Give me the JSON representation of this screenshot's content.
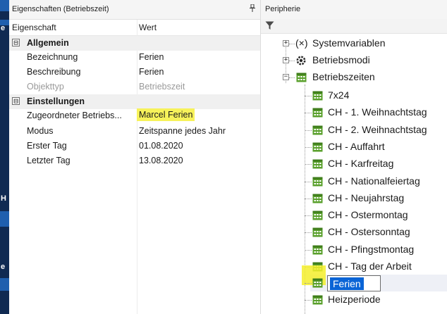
{
  "desktop": {
    "letters": [
      "e",
      "H",
      "e"
    ]
  },
  "properties_panel": {
    "title": "Eigenschaften (Betriebszeit)",
    "pin_icon": "pin-icon",
    "columns": {
      "property": "Eigenschaft",
      "value": "Wert"
    },
    "groups": [
      {
        "expander": "⊟",
        "label": "Allgemein",
        "rows": [
          {
            "label": "Bezeichnung",
            "value": "Ferien"
          },
          {
            "label": "Beschreibung",
            "value": "Ferien"
          },
          {
            "label": "Objekttyp",
            "value": "Betriebszeit",
            "dimmed": true
          }
        ]
      },
      {
        "expander": "⊟",
        "label": "Einstellungen",
        "rows": [
          {
            "label": "Zugeordneter Betriebs...",
            "value": "Marcel Ferien",
            "highlighted": true
          },
          {
            "label": "Modus",
            "value": "Zeitspanne jedes Jahr"
          },
          {
            "label": "Erster Tag",
            "value": "01.08.2020"
          },
          {
            "label": "Letzter Tag",
            "value": "13.08.2020"
          }
        ]
      }
    ]
  },
  "peripherie_panel": {
    "title": "Peripherie",
    "filter_icon": "filter-icon",
    "tree": {
      "top_nodes": [
        {
          "label": "Systemvariablen",
          "icon": "variable-icon",
          "icon_text": "(×)",
          "expander": "+"
        },
        {
          "label": "Betriebsmodi",
          "icon": "gear-icon",
          "expander": "+"
        },
        {
          "label": "Betriebszeiten",
          "icon": "calendar-icon",
          "expander": "−"
        }
      ],
      "children": [
        "7x24",
        "CH - 1. Weihnachtstag",
        "CH - 2. Weihnachtstag",
        "CH - Auffahrt",
        "CH - Karfreitag",
        "CH - Nationalfeiertag",
        "CH - Neujahrstag",
        "CH - Ostermontag",
        "CH - Ostersonntag",
        "CH - Pfingstmontag",
        "CH - Tag der Arbeit"
      ],
      "editing_node": {
        "value": "Ferien"
      },
      "after_edit": [
        "Heizperiode"
      ]
    }
  },
  "colors": {
    "highlight": "#f7f25a",
    "selection": "#0a64d6",
    "calendar_icon": "#5aa02c"
  }
}
